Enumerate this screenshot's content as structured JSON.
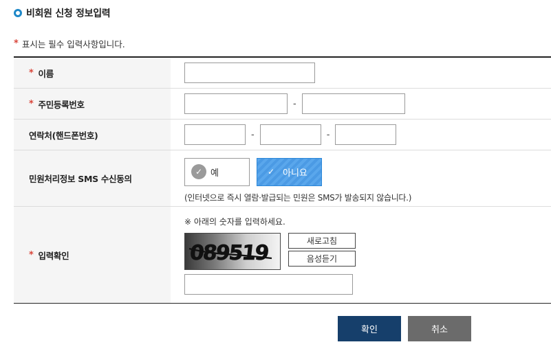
{
  "page": {
    "title": "비회원 신청 정보입력",
    "required_note": "표시는 필수 입력사항입니다.",
    "required_mark": "*"
  },
  "fields": {
    "name": {
      "label": "이름",
      "value": ""
    },
    "rrn": {
      "label": "주민등록번호",
      "separator": "-",
      "part1": "",
      "part2": ""
    },
    "phone": {
      "label": "연락처(핸드폰번호)",
      "separator": "-",
      "part1": "",
      "part2": "",
      "part3": ""
    },
    "sms": {
      "label": "민원처리정보 SMS 수신동의",
      "options": [
        {
          "label": "예",
          "selected": false
        },
        {
          "label": "아니요",
          "selected": true
        }
      ],
      "note": "(인터넷으로 즉시 열람·발급되는 민원은 SMS가 발송되지 않습니다.)"
    },
    "captcha": {
      "label": "입력확인",
      "guide": "※ 아래의 숫자를 입력하세요.",
      "code": "089519",
      "refresh_label": "새로고침",
      "audio_label": "음성듣기",
      "value": ""
    }
  },
  "buttons": {
    "confirm": "확인",
    "cancel": "취소"
  },
  "colors": {
    "accent": "#1e88c8",
    "required": "#d9453a",
    "selected": "#4b9ae4",
    "confirm_bg": "#163f6b",
    "cancel_bg": "#6b6b6b"
  }
}
